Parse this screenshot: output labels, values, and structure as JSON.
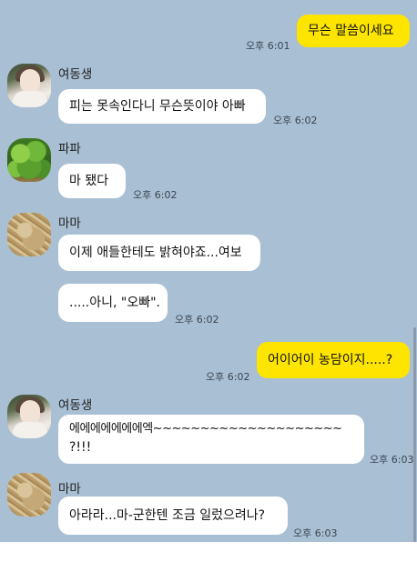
{
  "messages": [
    {
      "text": "무슨 말씀이세요",
      "time": "오후 6:01"
    },
    {
      "sender": "여동생",
      "text": "피는 못속인다니 무슨뜻이야 아빠",
      "time": "오후 6:02"
    },
    {
      "sender": "파파",
      "text": "마 됐다",
      "time": "오후 6:02"
    },
    {
      "sender": "마마",
      "text": "이제 애들한테도 밝혀야죠...여보"
    },
    {
      "text": ".....아니, \"오빠\".",
      "time": "오후 6:02"
    },
    {
      "text": "어이어이 농담이지.....?",
      "time": "오후 6:02"
    },
    {
      "sender": "여동생",
      "line1": "에에에에에에에엑~~~~~~~~~~~~~~~~~~~~",
      "line2": "?!!!",
      "time": "오후 6:03"
    },
    {
      "sender": "마마",
      "text": "아라라...마-군한텐 조금 일렀으려나?",
      "time": "오후 6:03"
    }
  ],
  "colors": {
    "chat_bg": "#a9bfd3",
    "sent_bubble": "#fee500",
    "recv_bubble": "#ffffff"
  }
}
